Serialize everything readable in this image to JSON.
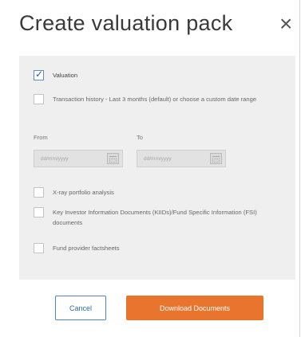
{
  "dialog": {
    "title": "Create valuation pack",
    "close_icon": "close-icon",
    "close_glyph": "×"
  },
  "options": [
    {
      "label": "Valuation",
      "checked": true
    },
    {
      "label": "Transaction history - Last 3 months (default) or choose a custom date range",
      "checked": false
    },
    {
      "label": "X-ray portfolio analysis",
      "checked": false
    },
    {
      "label": "Key Investor Information Documents (KIIDs)/Fund Specific Information (FSI) documents",
      "checked": false
    },
    {
      "label": "Fund provider factsheets",
      "checked": false
    }
  ],
  "date_range": {
    "from_label": "From",
    "to_label": "To",
    "from_placeholder": "dd/mm/yyyy",
    "to_placeholder": "dd/mm/yyyy"
  },
  "buttons": {
    "cancel": "Cancel",
    "download": "Download Documents"
  },
  "colors": {
    "accent_orange": "#e8742d",
    "accent_blue": "#4f86c2",
    "panel_bg": "#efefef"
  }
}
